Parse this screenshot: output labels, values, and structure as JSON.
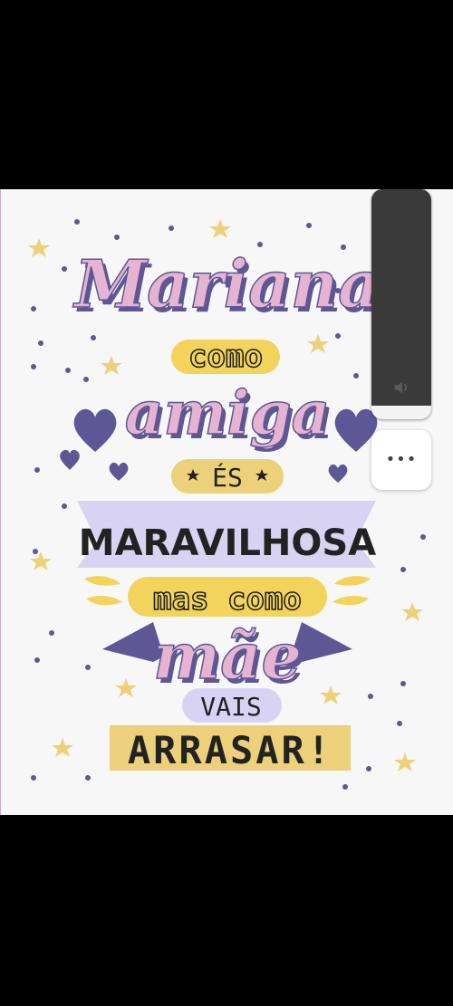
{
  "poster": {
    "line1": "Mariana",
    "line2": "como",
    "line3": "amiga",
    "line4": "ÉS",
    "line5": "MARAVILHOSA",
    "line6": "mas como",
    "line7": "mãe",
    "line8": "VAIS",
    "line9": "ARRASAR!"
  },
  "overlay": {
    "volume_icon": "speaker-icon",
    "more_icon": "more-options-icon",
    "more_label": "•••",
    "volume_level_fraction": 0.06
  },
  "colors": {
    "pink": "#e6b4d1",
    "purple": "#5e5796",
    "yellow": "#f2d35b",
    "lavender": "#d9d3f3",
    "dark": "#222222"
  }
}
